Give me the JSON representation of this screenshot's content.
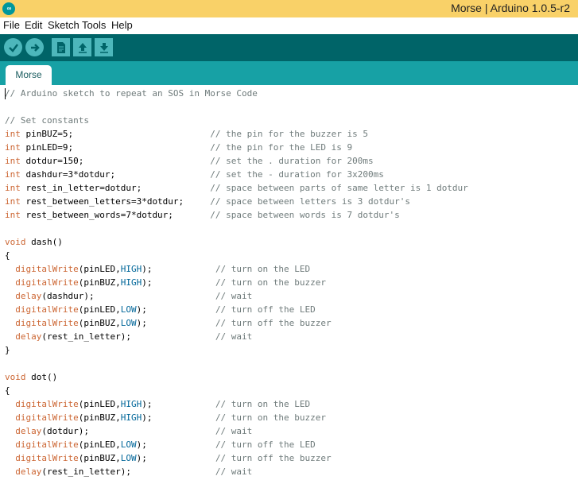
{
  "window": {
    "title": "Morse | Arduino 1.0.5-r2",
    "logo": "∞"
  },
  "menu": [
    {
      "label": "File"
    },
    {
      "label": "Edit"
    },
    {
      "label": "Sketch"
    },
    {
      "label": "Tools"
    },
    {
      "label": "Help"
    }
  ],
  "toolbar": {
    "buttons": [
      {
        "name": "verify",
        "icon": "checkmark-icon"
      },
      {
        "name": "upload",
        "icon": "arrow-right-icon"
      },
      {
        "name": "new",
        "icon": "document-icon"
      },
      {
        "name": "open",
        "icon": "arrow-up-icon"
      },
      {
        "name": "save",
        "icon": "arrow-down-icon"
      }
    ],
    "colors": {
      "bar": "#006468",
      "button": "#4db7bb",
      "tabbar": "#17a1a5",
      "titlebar": "#f9d168"
    }
  },
  "tabs": [
    {
      "label": "Morse",
      "active": true
    }
  ],
  "editor": {
    "lines": [
      [
        {
          "t": "// Arduino sketch to repeat an SOS in Morse Code",
          "c": "comment"
        }
      ],
      [],
      [
        {
          "t": "// Set constants",
          "c": "comment"
        }
      ],
      [
        {
          "t": "int",
          "c": "kw"
        },
        {
          "t": " pinBUZ=5;                          "
        },
        {
          "t": "// the pin for the buzzer is 5",
          "c": "comment"
        }
      ],
      [
        {
          "t": "int",
          "c": "kw"
        },
        {
          "t": " pinLED=9;                          "
        },
        {
          "t": "// the pin for the LED is 9",
          "c": "comment"
        }
      ],
      [
        {
          "t": "int",
          "c": "kw"
        },
        {
          "t": " dotdur=150;                        "
        },
        {
          "t": "// set the . duration for 200ms",
          "c": "comment"
        }
      ],
      [
        {
          "t": "int",
          "c": "kw"
        },
        {
          "t": " dashdur=3*dotdur;                  "
        },
        {
          "t": "// set the - duration for 3x200ms",
          "c": "comment"
        }
      ],
      [
        {
          "t": "int",
          "c": "kw"
        },
        {
          "t": " rest_in_letter=dotdur;             "
        },
        {
          "t": "// space between parts of same letter is 1 dotdur",
          "c": "comment"
        }
      ],
      [
        {
          "t": "int",
          "c": "kw"
        },
        {
          "t": " rest_between_letters=3*dotdur;     "
        },
        {
          "t": "// space between letters is 3 dotdur's",
          "c": "comment"
        }
      ],
      [
        {
          "t": "int",
          "c": "kw"
        },
        {
          "t": " rest_between_words=7*dotdur;       "
        },
        {
          "t": "// space between words is 7 dotdur's",
          "c": "comment"
        }
      ],
      [],
      [
        {
          "t": "void",
          "c": "kw"
        },
        {
          "t": " dash()"
        }
      ],
      [
        {
          "t": "{"
        }
      ],
      [
        {
          "t": "  "
        },
        {
          "t": "digitalWrite",
          "c": "fn"
        },
        {
          "t": "(pinLED,"
        },
        {
          "t": "HIGH",
          "c": "const"
        },
        {
          "t": ");            "
        },
        {
          "t": "// turn on the LED",
          "c": "comment"
        }
      ],
      [
        {
          "t": "  "
        },
        {
          "t": "digitalWrite",
          "c": "fn"
        },
        {
          "t": "(pinBUZ,"
        },
        {
          "t": "HIGH",
          "c": "const"
        },
        {
          "t": ");            "
        },
        {
          "t": "// turn on the buzzer",
          "c": "comment"
        }
      ],
      [
        {
          "t": "  "
        },
        {
          "t": "delay",
          "c": "fn"
        },
        {
          "t": "(dashdur);                       "
        },
        {
          "t": "// wait",
          "c": "comment"
        }
      ],
      [
        {
          "t": "  "
        },
        {
          "t": "digitalWrite",
          "c": "fn"
        },
        {
          "t": "(pinLED,"
        },
        {
          "t": "LOW",
          "c": "const"
        },
        {
          "t": ");             "
        },
        {
          "t": "// turn off the LED",
          "c": "comment"
        }
      ],
      [
        {
          "t": "  "
        },
        {
          "t": "digitalWrite",
          "c": "fn"
        },
        {
          "t": "(pinBUZ,"
        },
        {
          "t": "LOW",
          "c": "const"
        },
        {
          "t": ");             "
        },
        {
          "t": "// turn off the buzzer",
          "c": "comment"
        }
      ],
      [
        {
          "t": "  "
        },
        {
          "t": "delay",
          "c": "fn"
        },
        {
          "t": "(rest_in_letter);                "
        },
        {
          "t": "// wait",
          "c": "comment"
        }
      ],
      [
        {
          "t": "}"
        }
      ],
      [],
      [
        {
          "t": "void",
          "c": "kw"
        },
        {
          "t": " dot()"
        }
      ],
      [
        {
          "t": "{"
        }
      ],
      [
        {
          "t": "  "
        },
        {
          "t": "digitalWrite",
          "c": "fn"
        },
        {
          "t": "(pinLED,"
        },
        {
          "t": "HIGH",
          "c": "const"
        },
        {
          "t": ");            "
        },
        {
          "t": "// turn on the LED",
          "c": "comment"
        }
      ],
      [
        {
          "t": "  "
        },
        {
          "t": "digitalWrite",
          "c": "fn"
        },
        {
          "t": "(pinBUZ,"
        },
        {
          "t": "HIGH",
          "c": "const"
        },
        {
          "t": ");            "
        },
        {
          "t": "// turn on the buzzer",
          "c": "comment"
        }
      ],
      [
        {
          "t": "  "
        },
        {
          "t": "delay",
          "c": "fn"
        },
        {
          "t": "(dotdur);                        "
        },
        {
          "t": "// wait",
          "c": "comment"
        }
      ],
      [
        {
          "t": "  "
        },
        {
          "t": "digitalWrite",
          "c": "fn"
        },
        {
          "t": "(pinLED,"
        },
        {
          "t": "LOW",
          "c": "const"
        },
        {
          "t": ");             "
        },
        {
          "t": "// turn off the LED",
          "c": "comment"
        }
      ],
      [
        {
          "t": "  "
        },
        {
          "t": "digitalWrite",
          "c": "fn"
        },
        {
          "t": "(pinBUZ,"
        },
        {
          "t": "LOW",
          "c": "const"
        },
        {
          "t": ");             "
        },
        {
          "t": "// turn off the buzzer",
          "c": "comment"
        }
      ],
      [
        {
          "t": "  "
        },
        {
          "t": "delay",
          "c": "fn"
        },
        {
          "t": "(rest_in_letter);                "
        },
        {
          "t": "// wait",
          "c": "comment"
        }
      ]
    ]
  }
}
